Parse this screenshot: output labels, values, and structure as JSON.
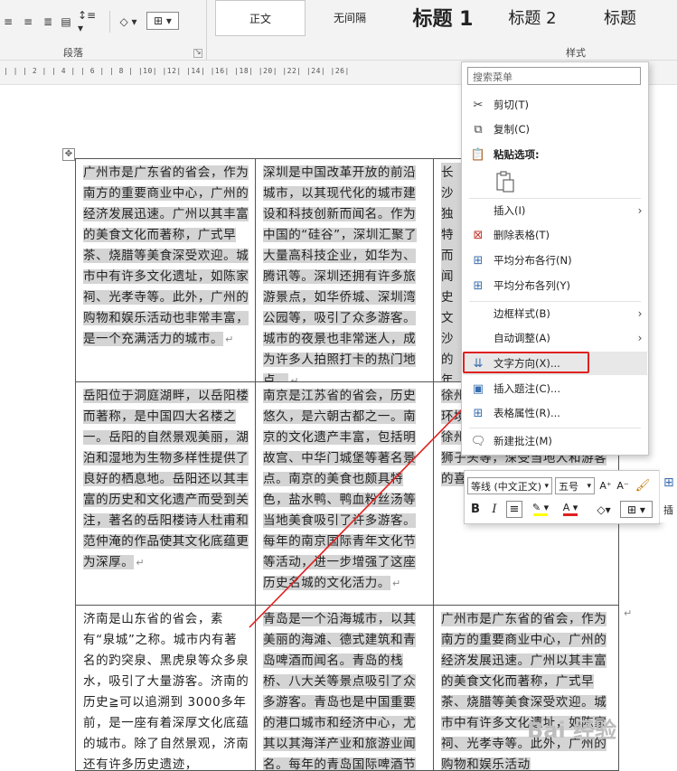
{
  "ribbon": {
    "paragraph_group_label": "段落",
    "styles_group_label": "样式",
    "styles": [
      {
        "label": "正文"
      },
      {
        "label": "无间隔"
      },
      {
        "label": "标题 1"
      },
      {
        "label": "标题 2"
      },
      {
        "label": "标题"
      }
    ]
  },
  "ruler": {
    "text": "| | | 2 | | 4 | | 6 | | 8 | |10| |12| |14| |16| |18| |20| |22| |24| |26|"
  },
  "table": {
    "rows": [
      [
        "广州市是广东省的省会，作为南方的重要商业中心，广州的经济发展迅速。广州以其丰富的美食文化而著称，广式早茶、烧腊等美食深受欢迎。城市中有许多文化遗址，如陈家祠、光孝寺等。此外，广州的购物和娱乐活动也非常丰富，是一个充满活力的城市。",
        "深圳是中国改革开放的前沿城市，以其现代化的城市建设和科技创新而闻名。作为中国的“硅谷”，深圳汇聚了大量高科技企业，如华为、腾讯等。深圳还拥有许多旅游景点，如华侨城、深圳湾公园等，吸引了众多游客。城市的夜景也非常迷人，成为许多人拍照打卡的热门地点。",
        "长沙独特而闻史文沙的年轻的美吃，深受"
      ],
      [
        "岳阳位于洞庭湖畔，以岳阳楼而著称，是中国四大名楼之一。岳阳的自然景观美丽，湖泊和湿地为生物多样性提供了良好的栖息地。岳阳还以其丰富的历史和文化遗产而受到关注，著名的岳阳楼诗人杜甫和范仲淹的作品使其文化底蕴更为深厚。",
        "南京是江苏省的省会，历史悠久，是六朝古都之一。南京的文化遗产丰富，包括明故宫、中华门城堡等著名景点。南京的美食也颇具特色，盐水鸭、鸭血粉丝汤等当地美食吸引了许多游客。每年的南京国际青年文化节等活动，进一步增强了这座历史名城的文化活力。",
        "徐州拥有在历拥有徐州以其市环境吸引着越来越多的游客。徐州的特色美食如徐州烤鸭、狮子头等，深受当地人和游客的喜爱。"
      ],
      [
        "济南是山东省的省会，素有“泉城”之称。城市内有著名的趵突泉、黑虎泉等众多泉水，吸引了大量游客。济南的历史≧可以追溯到 3000多年前，是一座有着深厚文化底蕴的城市。除了自然景观，济南还有许多历史遗迹，",
        "青岛是一个沿海城市，以其美丽的海滩、德式建筑和青岛啤酒而闻名。青岛的栈桥、八大关等景点吸引了众多游客。青岛也是中国重要的港口城市和经济中心，尤其以其海洋产业和旅游业闻名。每年的青岛国际啤酒节吸引",
        "广州市是广东省的省会，作为南方的重要商业中心，广州的经济发展迅速。广州以其丰富的美食文化而著称，广式早茶、烧腊等美食深受欢迎。城市中有许多文化遗址，如陈家祠、光孝寺等。此外，广州的购物和娱乐活动"
      ]
    ]
  },
  "context_menu": {
    "search_placeholder": "搜索菜单",
    "items": {
      "cut": "剪切(T)",
      "copy": "复制(C)",
      "paste_options": "粘贴选项:",
      "insert": "插入(I)",
      "delete_table": "删除表格(T)",
      "distribute_rows": "平均分布各行(N)",
      "distribute_cols": "平均分布各列(Y)",
      "border_styles": "边框样式(B)",
      "autofit": "自动调整(A)",
      "text_direction": "文字方向(X)...",
      "insert_caption": "插入题注(C)...",
      "table_properties": "表格属性(R)...",
      "new_comment": "新建批注(M)"
    }
  },
  "mini_toolbar": {
    "font": "等线 (中文正文)",
    "size": "五号",
    "grow": "A⁺",
    "shrink": "A⁻",
    "bold": "B",
    "italic": "I",
    "align": "≡",
    "insert_label": "插"
  },
  "watermark": "Bai 经验",
  "colors": {
    "highlight": "#ffff00",
    "font_color": "#e02020",
    "annotation": "#e02020"
  }
}
